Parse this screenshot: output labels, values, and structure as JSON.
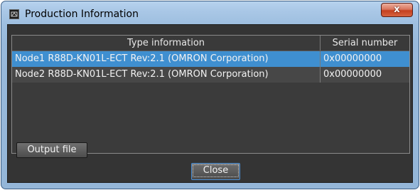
{
  "window": {
    "title": "Production Information",
    "close_label": "x"
  },
  "table": {
    "headers": {
      "type": "Type information",
      "serial": "Serial number"
    },
    "rows": [
      {
        "type": "Node1 R88D-KN01L-ECT Rev:2.1 (OMRON Corporation)",
        "serial": "0x00000000",
        "selected": true
      },
      {
        "type": "Node2 R88D-KN01L-ECT Rev:2.1 (OMRON Corporation)",
        "serial": "0x00000000",
        "selected": false
      }
    ]
  },
  "buttons": {
    "output_file": "Output file",
    "close": "Close"
  },
  "colors": {
    "selection": "#3f8fd0",
    "panel": "#343434",
    "chrome": "#9dbedf"
  }
}
